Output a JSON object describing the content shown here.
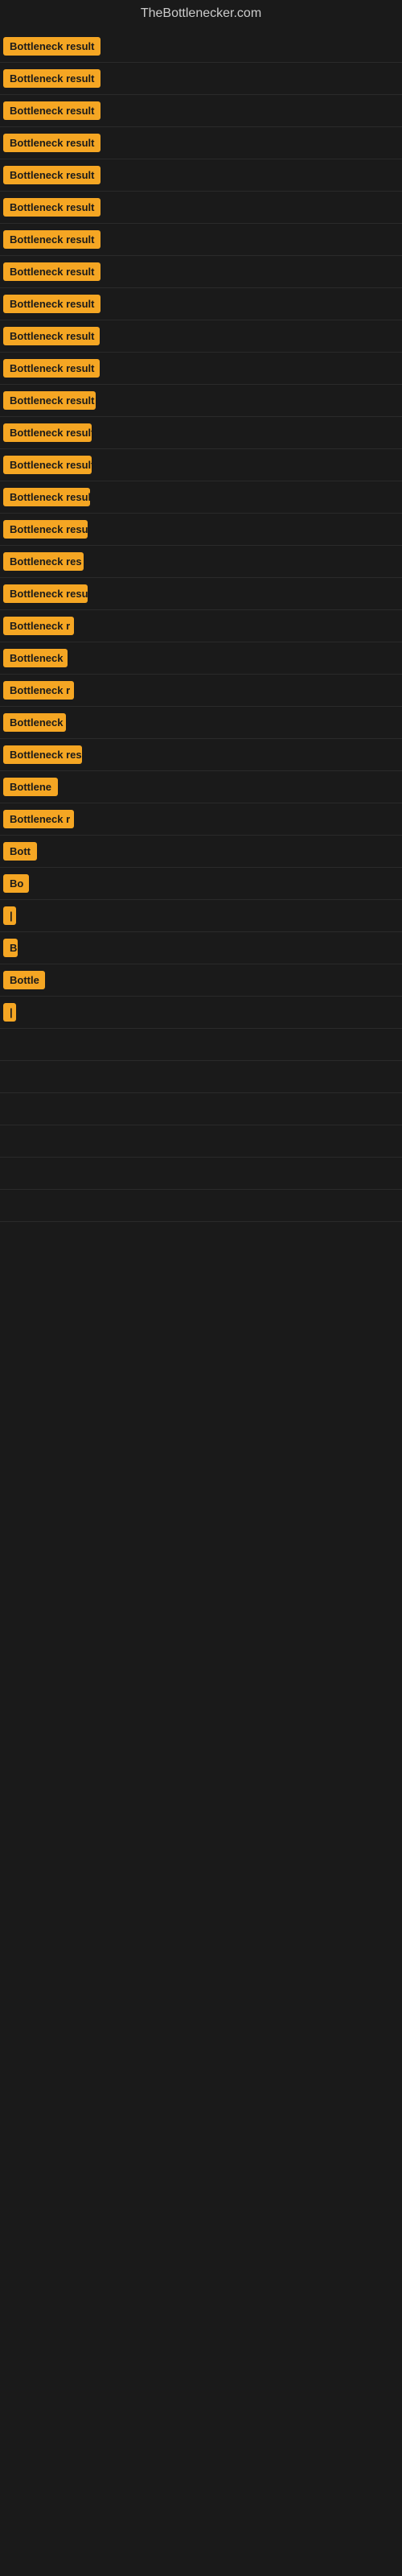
{
  "site": {
    "title": "TheBottlenecker.com"
  },
  "items": [
    {
      "id": 1,
      "label": "Bottleneck result",
      "width": 130
    },
    {
      "id": 2,
      "label": "Bottleneck result",
      "width": 130
    },
    {
      "id": 3,
      "label": "Bottleneck result",
      "width": 125
    },
    {
      "id": 4,
      "label": "Bottleneck result",
      "width": 125
    },
    {
      "id": 5,
      "label": "Bottleneck result",
      "width": 125
    },
    {
      "id": 6,
      "label": "Bottleneck result",
      "width": 125
    },
    {
      "id": 7,
      "label": "Bottleneck result",
      "width": 125
    },
    {
      "id": 8,
      "label": "Bottleneck result",
      "width": 125
    },
    {
      "id": 9,
      "label": "Bottleneck result",
      "width": 125
    },
    {
      "id": 10,
      "label": "Bottleneck result",
      "width": 120
    },
    {
      "id": 11,
      "label": "Bottleneck result",
      "width": 120
    },
    {
      "id": 12,
      "label": "Bottleneck result",
      "width": 115
    },
    {
      "id": 13,
      "label": "Bottleneck result",
      "width": 110
    },
    {
      "id": 14,
      "label": "Bottleneck result",
      "width": 110
    },
    {
      "id": 15,
      "label": "Bottleneck result",
      "width": 108
    },
    {
      "id": 16,
      "label": "Bottleneck result",
      "width": 105
    },
    {
      "id": 17,
      "label": "Bottleneck res",
      "width": 100
    },
    {
      "id": 18,
      "label": "Bottleneck result",
      "width": 105
    },
    {
      "id": 19,
      "label": "Bottleneck r",
      "width": 88
    },
    {
      "id": 20,
      "label": "Bottleneck",
      "width": 80
    },
    {
      "id": 21,
      "label": "Bottleneck r",
      "width": 88
    },
    {
      "id": 22,
      "label": "Bottleneck",
      "width": 78
    },
    {
      "id": 23,
      "label": "Bottleneck res",
      "width": 98
    },
    {
      "id": 24,
      "label": "Bottlene",
      "width": 72
    },
    {
      "id": 25,
      "label": "Bottleneck r",
      "width": 88
    },
    {
      "id": 26,
      "label": "Bott",
      "width": 48
    },
    {
      "id": 27,
      "label": "Bo",
      "width": 32
    },
    {
      "id": 28,
      "label": "|",
      "width": 10
    },
    {
      "id": 29,
      "label": "B",
      "width": 18
    },
    {
      "id": 30,
      "label": "Bottle",
      "width": 52
    },
    {
      "id": 31,
      "label": "|",
      "width": 8
    },
    {
      "id": 32,
      "label": "",
      "width": 0
    },
    {
      "id": 33,
      "label": "",
      "width": 0
    },
    {
      "id": 34,
      "label": "",
      "width": 0
    },
    {
      "id": 35,
      "label": "",
      "width": 0
    },
    {
      "id": 36,
      "label": "",
      "width": 0
    },
    {
      "id": 37,
      "label": "",
      "width": 0
    }
  ]
}
